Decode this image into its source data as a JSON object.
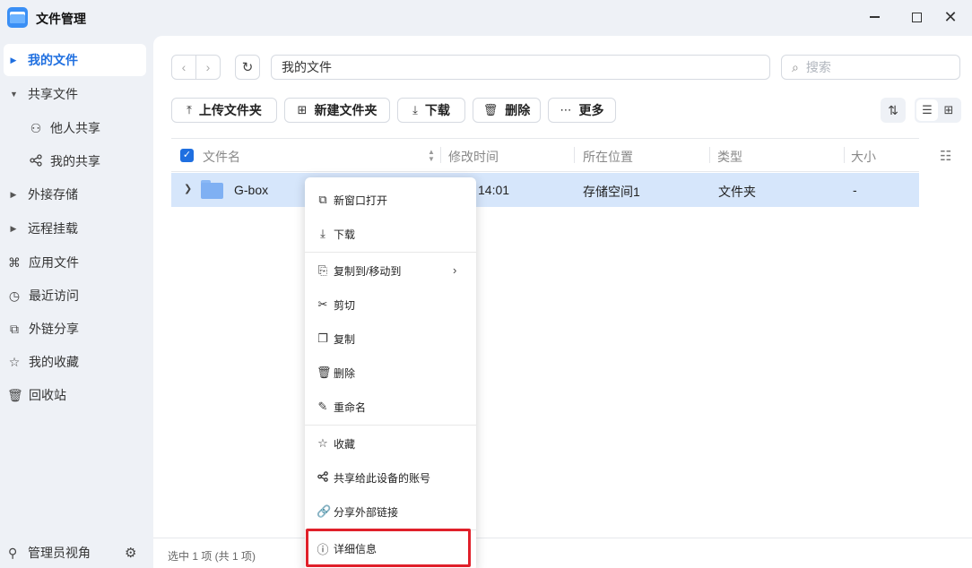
{
  "app": {
    "title": "文件管理"
  },
  "sidebar": {
    "items": [
      {
        "label": "我的文件",
        "icon": "caret-right-icon"
      },
      {
        "label": "共享文件",
        "icon": "caret-down-icon"
      },
      {
        "label": "他人共享",
        "icon": "users-icon"
      },
      {
        "label": "我的共享",
        "icon": "share-icon"
      },
      {
        "label": "外接存储",
        "icon": "caret-right-icon"
      },
      {
        "label": "远程挂载",
        "icon": "caret-right-icon"
      },
      {
        "label": "应用文件",
        "icon": "command-icon"
      },
      {
        "label": "最近访问",
        "icon": "clock-icon"
      },
      {
        "label": "外链分享",
        "icon": "external-share-icon"
      },
      {
        "label": "我的收藏",
        "icon": "star-icon"
      },
      {
        "label": "回收站",
        "icon": "trash-icon"
      }
    ],
    "footer_label": "管理员视角"
  },
  "path": {
    "value": "我的文件"
  },
  "search": {
    "placeholder": "搜索"
  },
  "toolbar": {
    "upload_label": "上传文件夹",
    "new_folder_label": "新建文件夹",
    "download_label": "下载",
    "delete_label": "删除",
    "more_label": "更多"
  },
  "table": {
    "columns": [
      "文件名",
      "修改时间",
      "所在位置",
      "类型",
      "大小"
    ],
    "rows": [
      {
        "name": "G-box",
        "modified": "14:01",
        "location": "存储空间1",
        "type": "文件夹",
        "size": "-"
      }
    ]
  },
  "status": {
    "text": "选中 1 项 (共 1 项)"
  },
  "context_menu": {
    "items": [
      "新窗口打开",
      "下载",
      "复制到/移动到",
      "剪切",
      "复制",
      "删除",
      "重命名",
      "收藏",
      "共享给此设备的账号",
      "分享外部链接",
      "详细信息"
    ]
  },
  "colors": {
    "accent": "#1f6fe0",
    "selected_row": "#d6e6fb",
    "highlight": "#e0202a"
  }
}
